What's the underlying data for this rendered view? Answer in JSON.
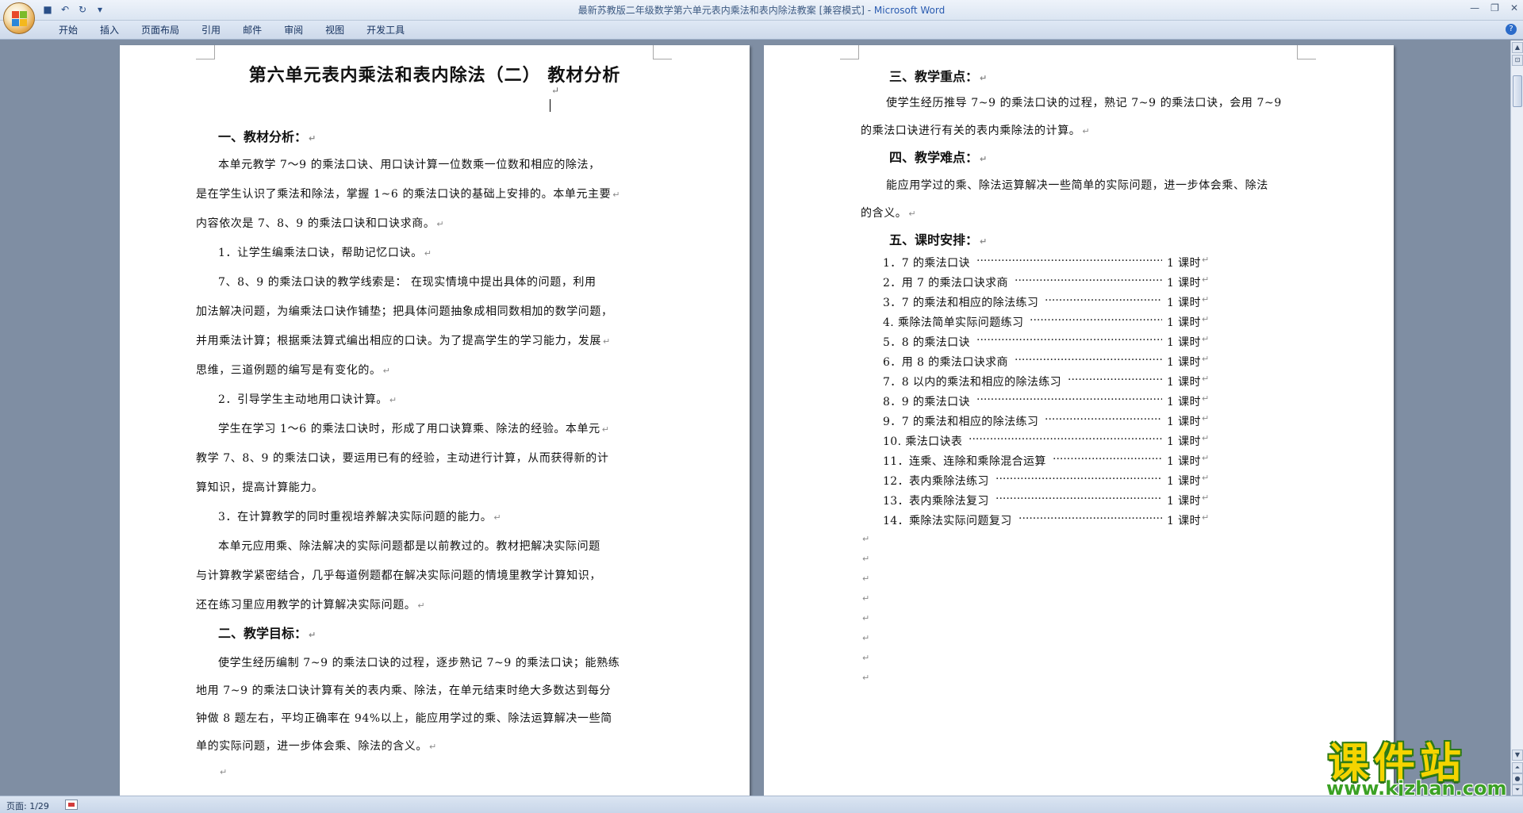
{
  "window": {
    "title": "最新苏教版二年级数学第六单元表内乘法和表内除法教案 [兼容模式] - ",
    "app_name": "Microsoft Word"
  },
  "quick_access": {
    "save": "💾",
    "undo": "↶",
    "redo": "↻",
    "more": "▾"
  },
  "ribbon": {
    "tabs": [
      "开始",
      "插入",
      "页面布局",
      "引用",
      "邮件",
      "审阅",
      "视图",
      "开发工具"
    ]
  },
  "page1": {
    "title": "第六单元表内乘法和表内除法（二）   教材分析",
    "h1": "一、教材分析：",
    "para1": [
      "本单元教学 7～9 的乘法口诀、用口诀计算一位数乘一位数和相应的除法，",
      "是在学生认识了乘法和除法，掌握 1~6 的乘法口诀的基础上安排的。本单元主要",
      "内容依次是 7、8、9 的乘法口诀和口诀求商。"
    ],
    "item1": "1．让学生编乘法口诀，帮助记忆口诀。",
    "para2": [
      "7、8、9 的乘法口诀的教学线索是：    在现实情境中提出具体的问题，利用",
      "加法解决问题，为编乘法口诀作铺垫；把具体问题抽象成相同数相加的数学问题，",
      "并用乘法计算；根据乘法算式编出相应的口诀。为了提高学生的学习能力，发展",
      "思维，三道例题的编写是有变化的。"
    ],
    "item2": "2．引导学生主动地用口诀计算。",
    "para3": [
      "学生在学习 1～6 的乘法口诀时，形成了用口诀算乘、除法的经验。本单元",
      "教学 7、8、9 的乘法口诀，要运用已有的经验，主动进行计算，从而获得新的计",
      "算知识，提高计算能力。"
    ],
    "item3": "3．在计算教学的同时重视培养解决实际问题的能力。",
    "para4": [
      "本单元应用乘、除法解决的实际问题都是以前教过的。教材把解决实际问题",
      "与计算教学紧密结合，几乎每道例题都在解决实际问题的情境里教学计算知识，",
      "还在练习里应用教学的计算解决实际问题。"
    ],
    "h2": "二、教学目标：",
    "para5": [
      "使学生经历编制 7~9 的乘法口诀的过程，逐步熟记 7~9 的乘法口诀；能熟练",
      "地用 7~9 的乘法口诀计算有关的表内乘、除法，在单元结束时绝大多数达到每分",
      "钟做 8 题左右，平均正确率在 94%以上，能应用学过的乘、除法运算解决一些简",
      "单的实际问题，进一步体会乘、除法的含义。"
    ]
  },
  "page2": {
    "h3": "三、教学重点：",
    "para1": [
      "使学生经历推导 7~9 的乘法口诀的过程，熟记 7~9 的乘法口诀，会用 7~9",
      "的乘法口诀进行有关的表内乘除法的计算。"
    ],
    "h4": "四、教学难点：",
    "para2": [
      "能应用学过的乘、除法运算解决一些简单的实际问题，进一步体会乘、除法",
      "的含义。"
    ],
    "h5": "五、课时安排：",
    "schedule": [
      {
        "label": "1．7 的乘法口诀",
        "hours": "1 课时"
      },
      {
        "label": "2．用 7 的乘法口诀求商",
        "hours": "1 课时"
      },
      {
        "label": "3．7 的乘法和相应的除法练习",
        "hours": "1 课时"
      },
      {
        "label": "4. 乘除法简单实际问题练习",
        "hours": "1 课时"
      },
      {
        "label": "5．8 的乘法口诀",
        "hours": "1 课时"
      },
      {
        "label": "6．用 8 的乘法口诀求商",
        "hours": "1 课时"
      },
      {
        "label": "7．8 以内的乘法和相应的除法练习",
        "hours": "1 课时"
      },
      {
        "label": "8．9 的乘法口诀",
        "hours": "1 课时"
      },
      {
        "label": "9．7 的乘法和相应的除法练习",
        "hours": "1 课时"
      },
      {
        "label": "10. 乘法口诀表",
        "hours": "1 课时"
      },
      {
        "label": "11．连乘、连除和乘除混合运算",
        "hours": "1 课时"
      },
      {
        "label": "12．表内乘除法练习",
        "hours": "1 课时"
      },
      {
        "label": "13．表内乘除法复习",
        "hours": "1 课时"
      },
      {
        "label": "14．乘除法实际问题复习",
        "hours": "1 课时"
      }
    ]
  },
  "pilcrow": "↵",
  "status": {
    "page": "页面: 1/29"
  },
  "watermark": {
    "big": "课件站",
    "url": "www.kjzhan.com"
  }
}
